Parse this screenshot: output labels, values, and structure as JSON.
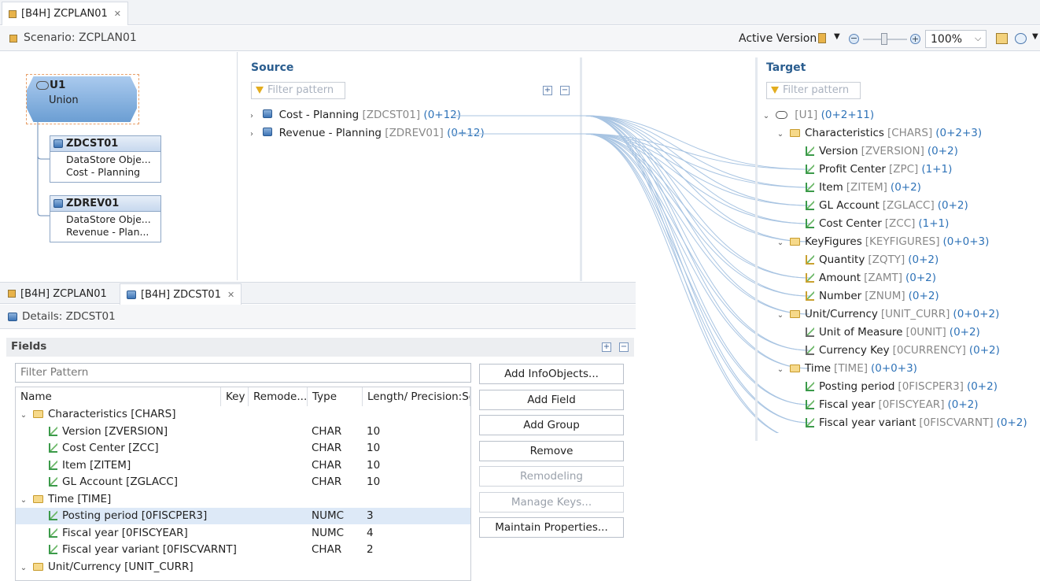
{
  "editor_tabs": [
    {
      "label": "[B4H] ZCPLAN01",
      "active": true
    }
  ],
  "scenario": {
    "title": "Scenario: ZCPLAN01",
    "active_version": "Active Version",
    "zoom": "100%"
  },
  "union_node": {
    "id": "U1",
    "label": "Union"
  },
  "source_nodes": [
    {
      "id": "ZDCST01",
      "line1": "DataStore Obje...",
      "line2": "Cost - Planning"
    },
    {
      "id": "ZDREV01",
      "line1": "DataStore Obje...",
      "line2": "Revenue - Plan..."
    }
  ],
  "source": {
    "title": "Source",
    "filter_placeholder": "Filter pattern",
    "items": [
      {
        "name": "Cost - Planning",
        "tech": "[ZDCST01]",
        "count": "(0+12)"
      },
      {
        "name": "Revenue - Planning",
        "tech": "[ZDREV01]",
        "count": "(0+12)"
      }
    ]
  },
  "target": {
    "title": "Target",
    "filter_placeholder": "Filter pattern",
    "root": {
      "name": "[U1]",
      "count": "(0+2+11)"
    },
    "rows": [
      {
        "level": 1,
        "kind": "folder",
        "name": "Characteristics",
        "tech": "[CHARS]",
        "count": "(0+2+3)"
      },
      {
        "level": 2,
        "kind": "char",
        "name": "Version",
        "tech": "[ZVERSION]",
        "count": "(0+2)"
      },
      {
        "level": 2,
        "kind": "char",
        "name": "Profit Center",
        "tech": "[ZPC]",
        "count": "(1+1)"
      },
      {
        "level": 2,
        "kind": "char",
        "name": "Item",
        "tech": "[ZITEM]",
        "count": "(0+2)"
      },
      {
        "level": 2,
        "kind": "char",
        "name": "GL Account",
        "tech": "[ZGLACC]",
        "count": "(0+2)"
      },
      {
        "level": 2,
        "kind": "char",
        "name": "Cost Center",
        "tech": "[ZCC]",
        "count": "(1+1)"
      },
      {
        "level": 1,
        "kind": "folder",
        "name": "KeyFigures",
        "tech": "[KEYFIGURES]",
        "count": "(0+0+3)"
      },
      {
        "level": 2,
        "kind": "kf",
        "name": "Quantity",
        "tech": "[ZQTY]",
        "count": "(0+2)"
      },
      {
        "level": 2,
        "kind": "kf",
        "name": "Amount",
        "tech": "[ZAMT]",
        "count": "(0+2)"
      },
      {
        "level": 2,
        "kind": "kf",
        "name": "Number",
        "tech": "[ZNUM]",
        "count": "(0+2)"
      },
      {
        "level": 1,
        "kind": "folder",
        "name": "Unit/Currency",
        "tech": "[UNIT_CURR]",
        "count": "(0+0+2)"
      },
      {
        "level": 2,
        "kind": "unit",
        "name": "Unit of Measure",
        "tech": "[0UNIT]",
        "count": "(0+2)"
      },
      {
        "level": 2,
        "kind": "unit",
        "name": "Currency Key",
        "tech": "[0CURRENCY]",
        "count": "(0+2)"
      },
      {
        "level": 1,
        "kind": "folder",
        "name": "Time",
        "tech": "[TIME]",
        "count": "(0+0+3)"
      },
      {
        "level": 2,
        "kind": "time",
        "name": "Posting period",
        "tech": "[0FISCPER3]",
        "count": "(0+2)"
      },
      {
        "level": 2,
        "kind": "time",
        "name": "Fiscal year",
        "tech": "[0FISCYEAR]",
        "count": "(0+2)"
      },
      {
        "level": 2,
        "kind": "time",
        "name": "Fiscal year variant",
        "tech": "[0FISCVARNT]",
        "count": "(0+2)"
      }
    ]
  },
  "bottom_tabs": [
    {
      "label": "[B4H] ZCPLAN01"
    },
    {
      "label": "[B4H] ZDCST01"
    }
  ],
  "details": {
    "title": "Details: ZDCST01",
    "fields_title": "Fields",
    "filter_placeholder": "Filter Pattern",
    "columns": [
      "Name",
      "Key",
      "Remode...",
      "Type",
      "Length/ Precision:Sca"
    ],
    "rows": [
      {
        "level": 1,
        "kind": "folder",
        "name": "Characteristics [CHARS]",
        "type": "",
        "len": ""
      },
      {
        "level": 2,
        "kind": "char",
        "name": "Version [ZVERSION]",
        "type": "CHAR",
        "len": "10"
      },
      {
        "level": 2,
        "kind": "char",
        "name": "Cost Center [ZCC]",
        "type": "CHAR",
        "len": "10"
      },
      {
        "level": 2,
        "kind": "char",
        "name": "Item [ZITEM]",
        "type": "CHAR",
        "len": "10"
      },
      {
        "level": 2,
        "kind": "char",
        "name": "GL Account [ZGLACC]",
        "type": "CHAR",
        "len": "10"
      },
      {
        "level": 1,
        "kind": "folder",
        "name": "Time [TIME]",
        "type": "",
        "len": ""
      },
      {
        "level": 2,
        "kind": "time",
        "name": "Posting period [0FISCPER3]",
        "type": "NUMC",
        "len": "3",
        "selected": true
      },
      {
        "level": 2,
        "kind": "time",
        "name": "Fiscal year [0FISCYEAR]",
        "type": "NUMC",
        "len": "4"
      },
      {
        "level": 2,
        "kind": "time",
        "name": "Fiscal year variant [0FISCVARNT]",
        "type": "CHAR",
        "len": "2"
      },
      {
        "level": 1,
        "kind": "folder",
        "name": "Unit/Currency [UNIT_CURR]",
        "type": "",
        "len": ""
      }
    ],
    "buttons": [
      {
        "label": "Add InfoObjects...",
        "enabled": true
      },
      {
        "label": "Add Field",
        "enabled": true
      },
      {
        "label": "Add Group",
        "enabled": true
      },
      {
        "label": "Remove",
        "enabled": true
      },
      {
        "label": "Remodeling",
        "enabled": false
      },
      {
        "label": "Manage Keys...",
        "enabled": false
      },
      {
        "label": "Maintain Properties...",
        "enabled": true
      }
    ]
  }
}
